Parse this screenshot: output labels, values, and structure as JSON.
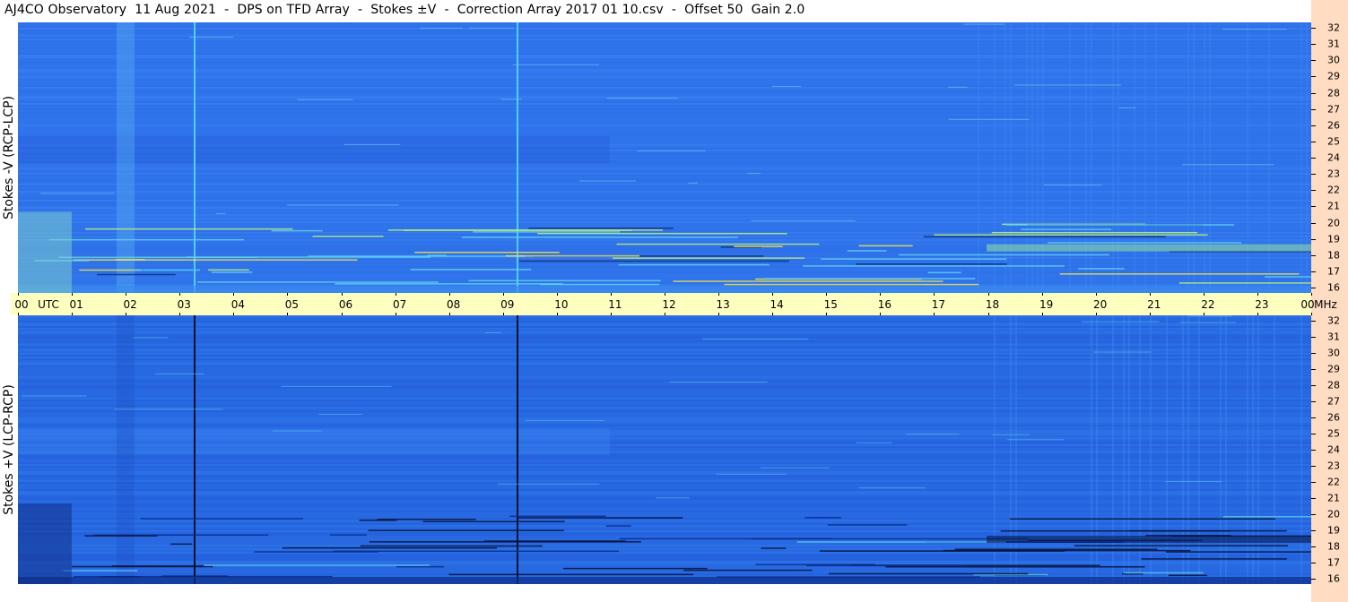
{
  "header": {
    "title": "AJ4CO Observatory  11 Aug 2021  -  DPS on TFD Array  -  Stokes ±V  -  Correction Array 2017 01 10.csv  -  Offset 50  Gain 2.0"
  },
  "colors": {
    "background_blue": "#2f6fe6",
    "right_stripe": "#ffdcc2",
    "time_bar": "#ffffc0"
  },
  "chart_data": [
    {
      "type": "heatmap",
      "panel": "top",
      "ylabel": "Stokes -V (RCP-LCP)",
      "y_unit": "MHz",
      "ylim": [
        16,
        32
      ],
      "yticks": [
        "32",
        "31",
        "30",
        "29",
        "28",
        "27",
        "26",
        "25",
        "24",
        "23",
        "22",
        "21",
        "20",
        "19",
        "18",
        "17",
        "16"
      ],
      "x_unit": "UTC",
      "xlim": [
        0,
        24
      ]
    },
    {
      "type": "heatmap",
      "panel": "bottom",
      "ylabel": "Stokes +V (LCP-RCP)",
      "y_unit": "MHz",
      "ylim": [
        16,
        32
      ],
      "yticks": [
        "32",
        "31",
        "30",
        "29",
        "28",
        "27",
        "26",
        "25",
        "24",
        "23",
        "22",
        "21",
        "20",
        "19",
        "18",
        "17",
        "16"
      ],
      "x_unit": "UTC",
      "xlim": [
        0,
        24
      ]
    }
  ],
  "time_axis": {
    "labels": [
      "00",
      "01",
      "02",
      "03",
      "04",
      "05",
      "06",
      "07",
      "08",
      "09",
      "10",
      "11",
      "12",
      "13",
      "14",
      "15",
      "16",
      "17",
      "18",
      "19",
      "20",
      "21",
      "22",
      "23",
      "00"
    ],
    "utc_label": "UTC",
    "mhz_label": "MHz"
  }
}
